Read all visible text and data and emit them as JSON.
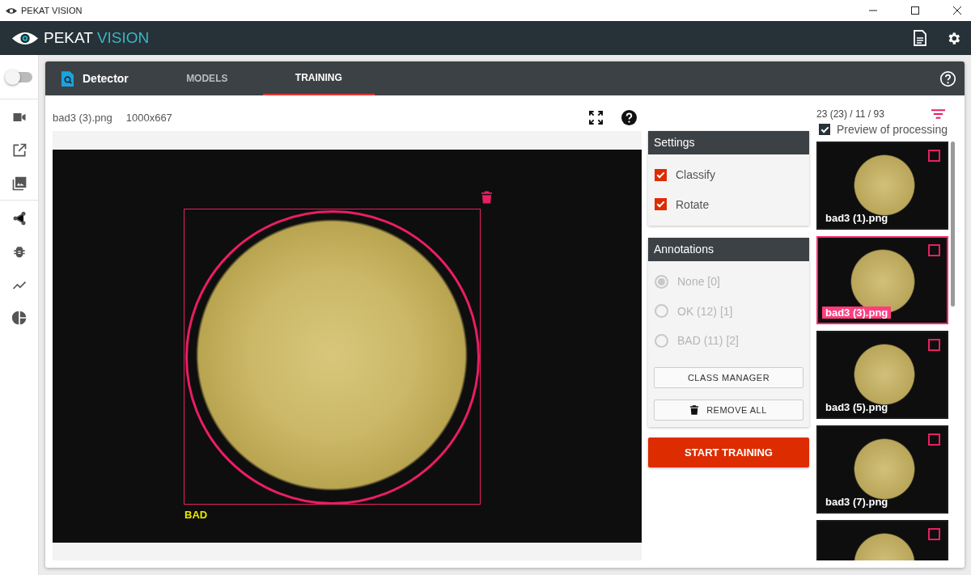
{
  "window": {
    "title": "PEKAT VISION"
  },
  "app_header": {
    "logo_left": "PEKAT",
    "logo_right": "VISION"
  },
  "sidebar": {
    "toggle": {
      "on": false
    }
  },
  "card": {
    "title": "Detector",
    "tabs": [
      {
        "label": "MODELS",
        "selected": false
      },
      {
        "label": "TRAINING",
        "selected": true
      }
    ]
  },
  "image_info": {
    "filename": "bad3 (3).png",
    "size": "1000x667"
  },
  "annotation": {
    "label": "BAD"
  },
  "settings": {
    "title": "Settings",
    "options": [
      {
        "label": "Classify",
        "checked": true
      },
      {
        "label": "Rotate",
        "checked": true
      }
    ]
  },
  "annotations": {
    "title": "Annotations",
    "disabled": true,
    "options": [
      {
        "label": "None [0]",
        "selected": true
      },
      {
        "label": "OK (12) [1]",
        "selected": false
      },
      {
        "label": "BAD (11) [2]",
        "selected": false
      }
    ],
    "buttons": [
      {
        "label": "CLASS MANAGER",
        "kind": "plain"
      },
      {
        "label": "REMOVE ALL",
        "kind": "delete"
      }
    ]
  },
  "start_button": "START TRAINING",
  "gallery": {
    "count": "23 (23) / 11 / 93",
    "preview": {
      "label": "Preview of processing",
      "checked": true
    },
    "thumbnails": [
      {
        "name": "bad3 (1).png",
        "selected": false,
        "checked": false
      },
      {
        "name": "bad3 (3).png",
        "selected": true,
        "checked": false
      },
      {
        "name": "bad3 (5).png",
        "selected": false,
        "checked": false
      },
      {
        "name": "bad3 (7).png",
        "selected": false,
        "checked": false
      },
      {
        "selected": false,
        "checked": false
      }
    ]
  }
}
